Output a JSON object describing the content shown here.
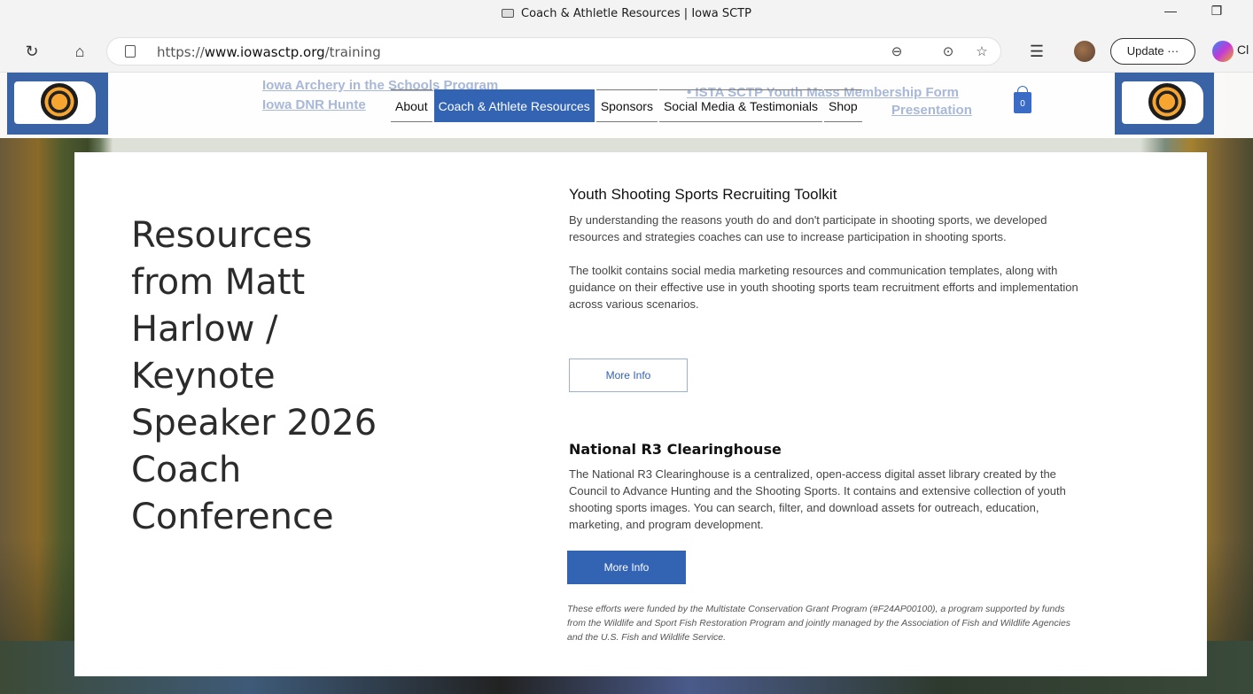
{
  "browser": {
    "tab_title": "Coach & Athletle Resources | Iowa SCTP",
    "url_prefix": "https://",
    "url_domain": "www.iowasctp.org",
    "url_path": "/training",
    "update_label": "Update",
    "update_more": "···",
    "copilot_label": "Cl"
  },
  "header": {
    "ghost_links": [
      "Iowa Archery in the Schools Program",
      "Iowa DNR Hunte",
      "• ISTA SCTP Youth Mass Membership Form",
      "Presentation"
    ],
    "nav": [
      "About",
      "Coach & Athlete Resources",
      "Sponsors",
      "Social Media & Testimonials",
      "Shop"
    ],
    "active_nav": "Coach & Athlete Resources",
    "cart_count": "0"
  },
  "main": {
    "big_title": "Resources from Matt Harlow / Keynote Speaker 2026 Coach Conference",
    "section1": {
      "heading": "Youth Shooting Sports Recruiting Toolkit",
      "para1": "By understanding the reasons youth do and don't participate in shooting sports, we developed resources and strategies coaches can use to increase participation in shooting sports.",
      "para2": "The toolkit contains social media marketing resources and communication templates, along with guidance on their effective use in youth shooting sports team recruitment efforts and implementation across various scenarios.",
      "button": "More Info"
    },
    "section2": {
      "heading": "National R3 Clearinghouse",
      "para": "The National R3 Clearinghouse is a centralized, open-access digital asset library created by the Council to Advance Hunting and the Shooting Sports. It contains and extensive collection of youth shooting sports images. You can search, filter, and download assets for outreach, education, marketing, and program development.",
      "button": "More Info"
    },
    "funding": "These efforts were funded by the Multistate Conservation Grant Program (#F24AP00100), a program supported by funds from the Wildlife and Sport Fish Restoration Program and jointly managed by the Association of Fish and Wildlife Agencies and the U.S. Fish and Wildlife Service."
  },
  "colors": {
    "accent": "#3363b3",
    "logo_bg": "#3a63a6"
  }
}
